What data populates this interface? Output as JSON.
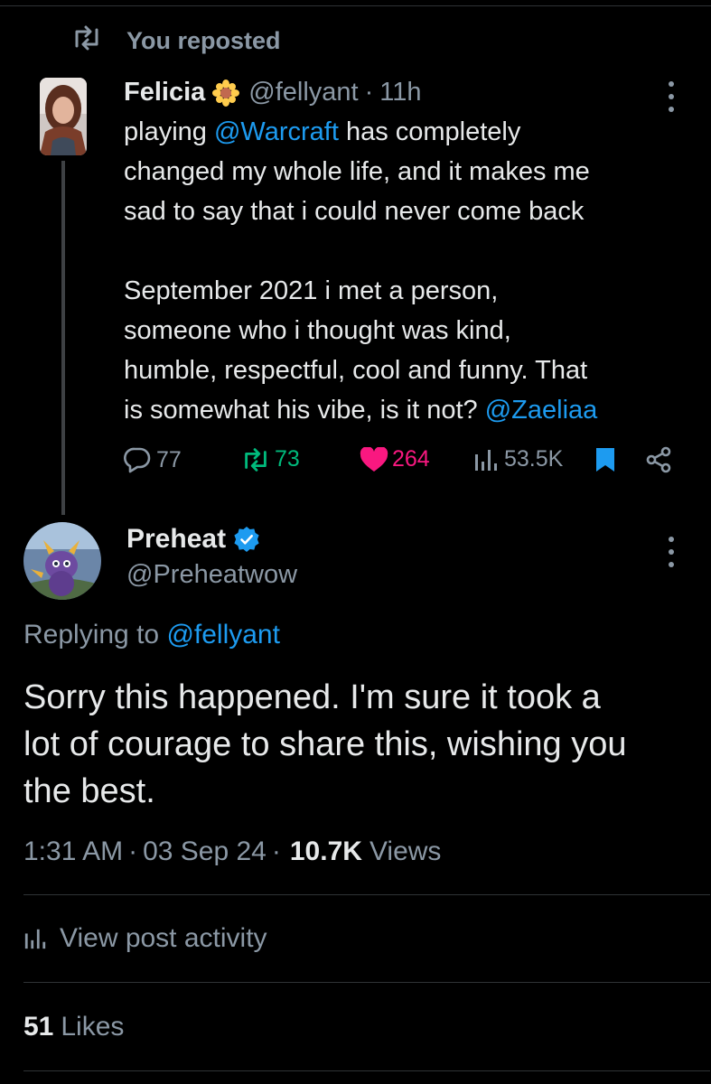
{
  "repost": {
    "label": "You reposted"
  },
  "original_post": {
    "author_name": "Felicia",
    "author_handle": "@fellyant",
    "separator": "·",
    "time": "11h",
    "lines": [
      [
        {
          "text": "playing "
        },
        {
          "text": "@Warcraft",
          "mention": true
        },
        {
          "text": " has completely"
        }
      ],
      [
        {
          "text": "changed my whole life, and it makes me"
        }
      ],
      [
        {
          "text": "sad to say that i could never come back"
        }
      ],
      [],
      [
        {
          "text": "September 2021 i met a person,"
        }
      ],
      [
        {
          "text": "someone who i thought was kind,"
        }
      ],
      [
        {
          "text": "humble, respectful, cool and funny. That"
        }
      ],
      [
        {
          "text": "is somewhat his vibe, is it not? "
        },
        {
          "text": "@Zaeliaa",
          "mention": true
        }
      ]
    ],
    "stats": {
      "replies": "77",
      "reposts": "73",
      "likes": "264",
      "views": "53.5K"
    },
    "colors": {
      "repost": "#00ba7c",
      "like": "#f91880",
      "bookmark": "#1d9bf0",
      "mention": "#1d9bf0"
    }
  },
  "reply_post": {
    "author_name": "Preheat",
    "author_handle": "@Preheatwow",
    "verified": true,
    "replying_prefix": "Replying to",
    "replying_handle": "@fellyant",
    "text_lines": [
      "Sorry this happened. I'm sure it took a",
      "lot of courage to share this, wishing you",
      "the best."
    ],
    "time": "1:31 AM",
    "date": "03 Sep 24",
    "separator": "·",
    "views_count": "10.7K",
    "views_label": "Views",
    "activity_label": "View post activity",
    "likes_count": "51",
    "likes_label": "Likes"
  },
  "icons": {
    "repost": "repost-icon",
    "more": "more-icon",
    "reply": "reply-icon",
    "like": "heart-icon",
    "views": "analytics-icon",
    "bookmark": "bookmark-icon",
    "share": "share-icon",
    "verified": "verified-badge-icon",
    "flower": "sunflower-emoji-icon"
  }
}
